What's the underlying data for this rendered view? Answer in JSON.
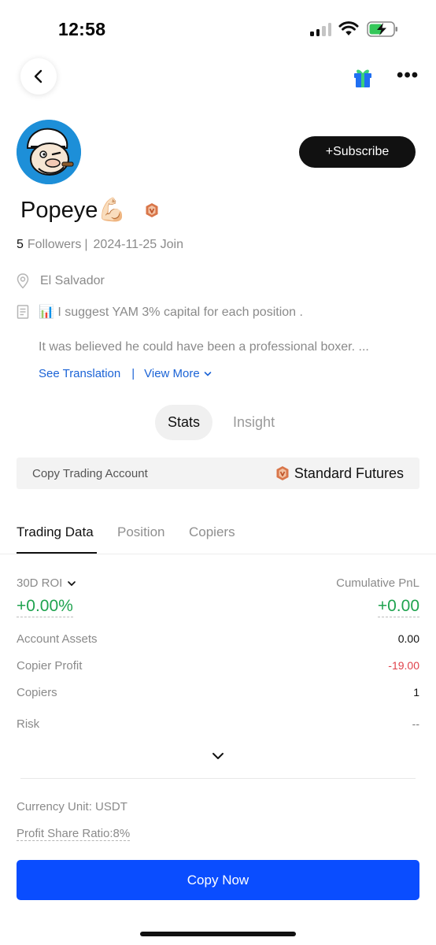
{
  "status_bar": {
    "time": "12:58"
  },
  "nav": {
    "back_icon": "chevron-left-icon",
    "gift_icon": "gift-icon",
    "more_label": "•••"
  },
  "profile": {
    "name": "Popeye💪🏻",
    "subscribe_label": "+Subscribe",
    "followers_count": "5",
    "followers_label": "Followers",
    "separator": "|",
    "join_text": "2024-11-25 Join",
    "location": "El Salvador",
    "bio_line1": "📊 I suggest YAM 3% capital for each position .",
    "bio_line2": "It was believed he could have been a professional boxer. ...",
    "see_translation": "See Translation",
    "link_separator": "|",
    "view_more": "View More"
  },
  "stats_tabs": [
    {
      "label": "Stats",
      "active": true
    },
    {
      "label": "Insight",
      "active": false
    }
  ],
  "account": {
    "label": "Copy Trading Account",
    "value": "Standard Futures"
  },
  "main_tabs": [
    {
      "label": "Trading Data",
      "active": true
    },
    {
      "label": "Position",
      "active": false
    },
    {
      "label": "Copiers",
      "active": false
    }
  ],
  "trading_data": {
    "roi_label": "30D ROI",
    "roi_value": "+0.00%",
    "pnl_label": "Cumulative PnL",
    "pnl_value": "+0.00",
    "rows": [
      {
        "label": "Account Assets",
        "value": "0.00"
      },
      {
        "label": "Copier Profit",
        "value": "-19.00"
      },
      {
        "label": "Copiers",
        "value": "1"
      },
      {
        "label": "Risk",
        "value": "--"
      }
    ]
  },
  "footer_info": {
    "currency": "Currency Unit: USDT",
    "ratio": "Profit Share Ratio:8%"
  },
  "copy_button": "Copy Now",
  "colors": {
    "accent_blue": "#0a4dff",
    "positive_green": "#1fa34f",
    "negative_red": "#e0424b",
    "link_blue": "#1b63d6"
  }
}
